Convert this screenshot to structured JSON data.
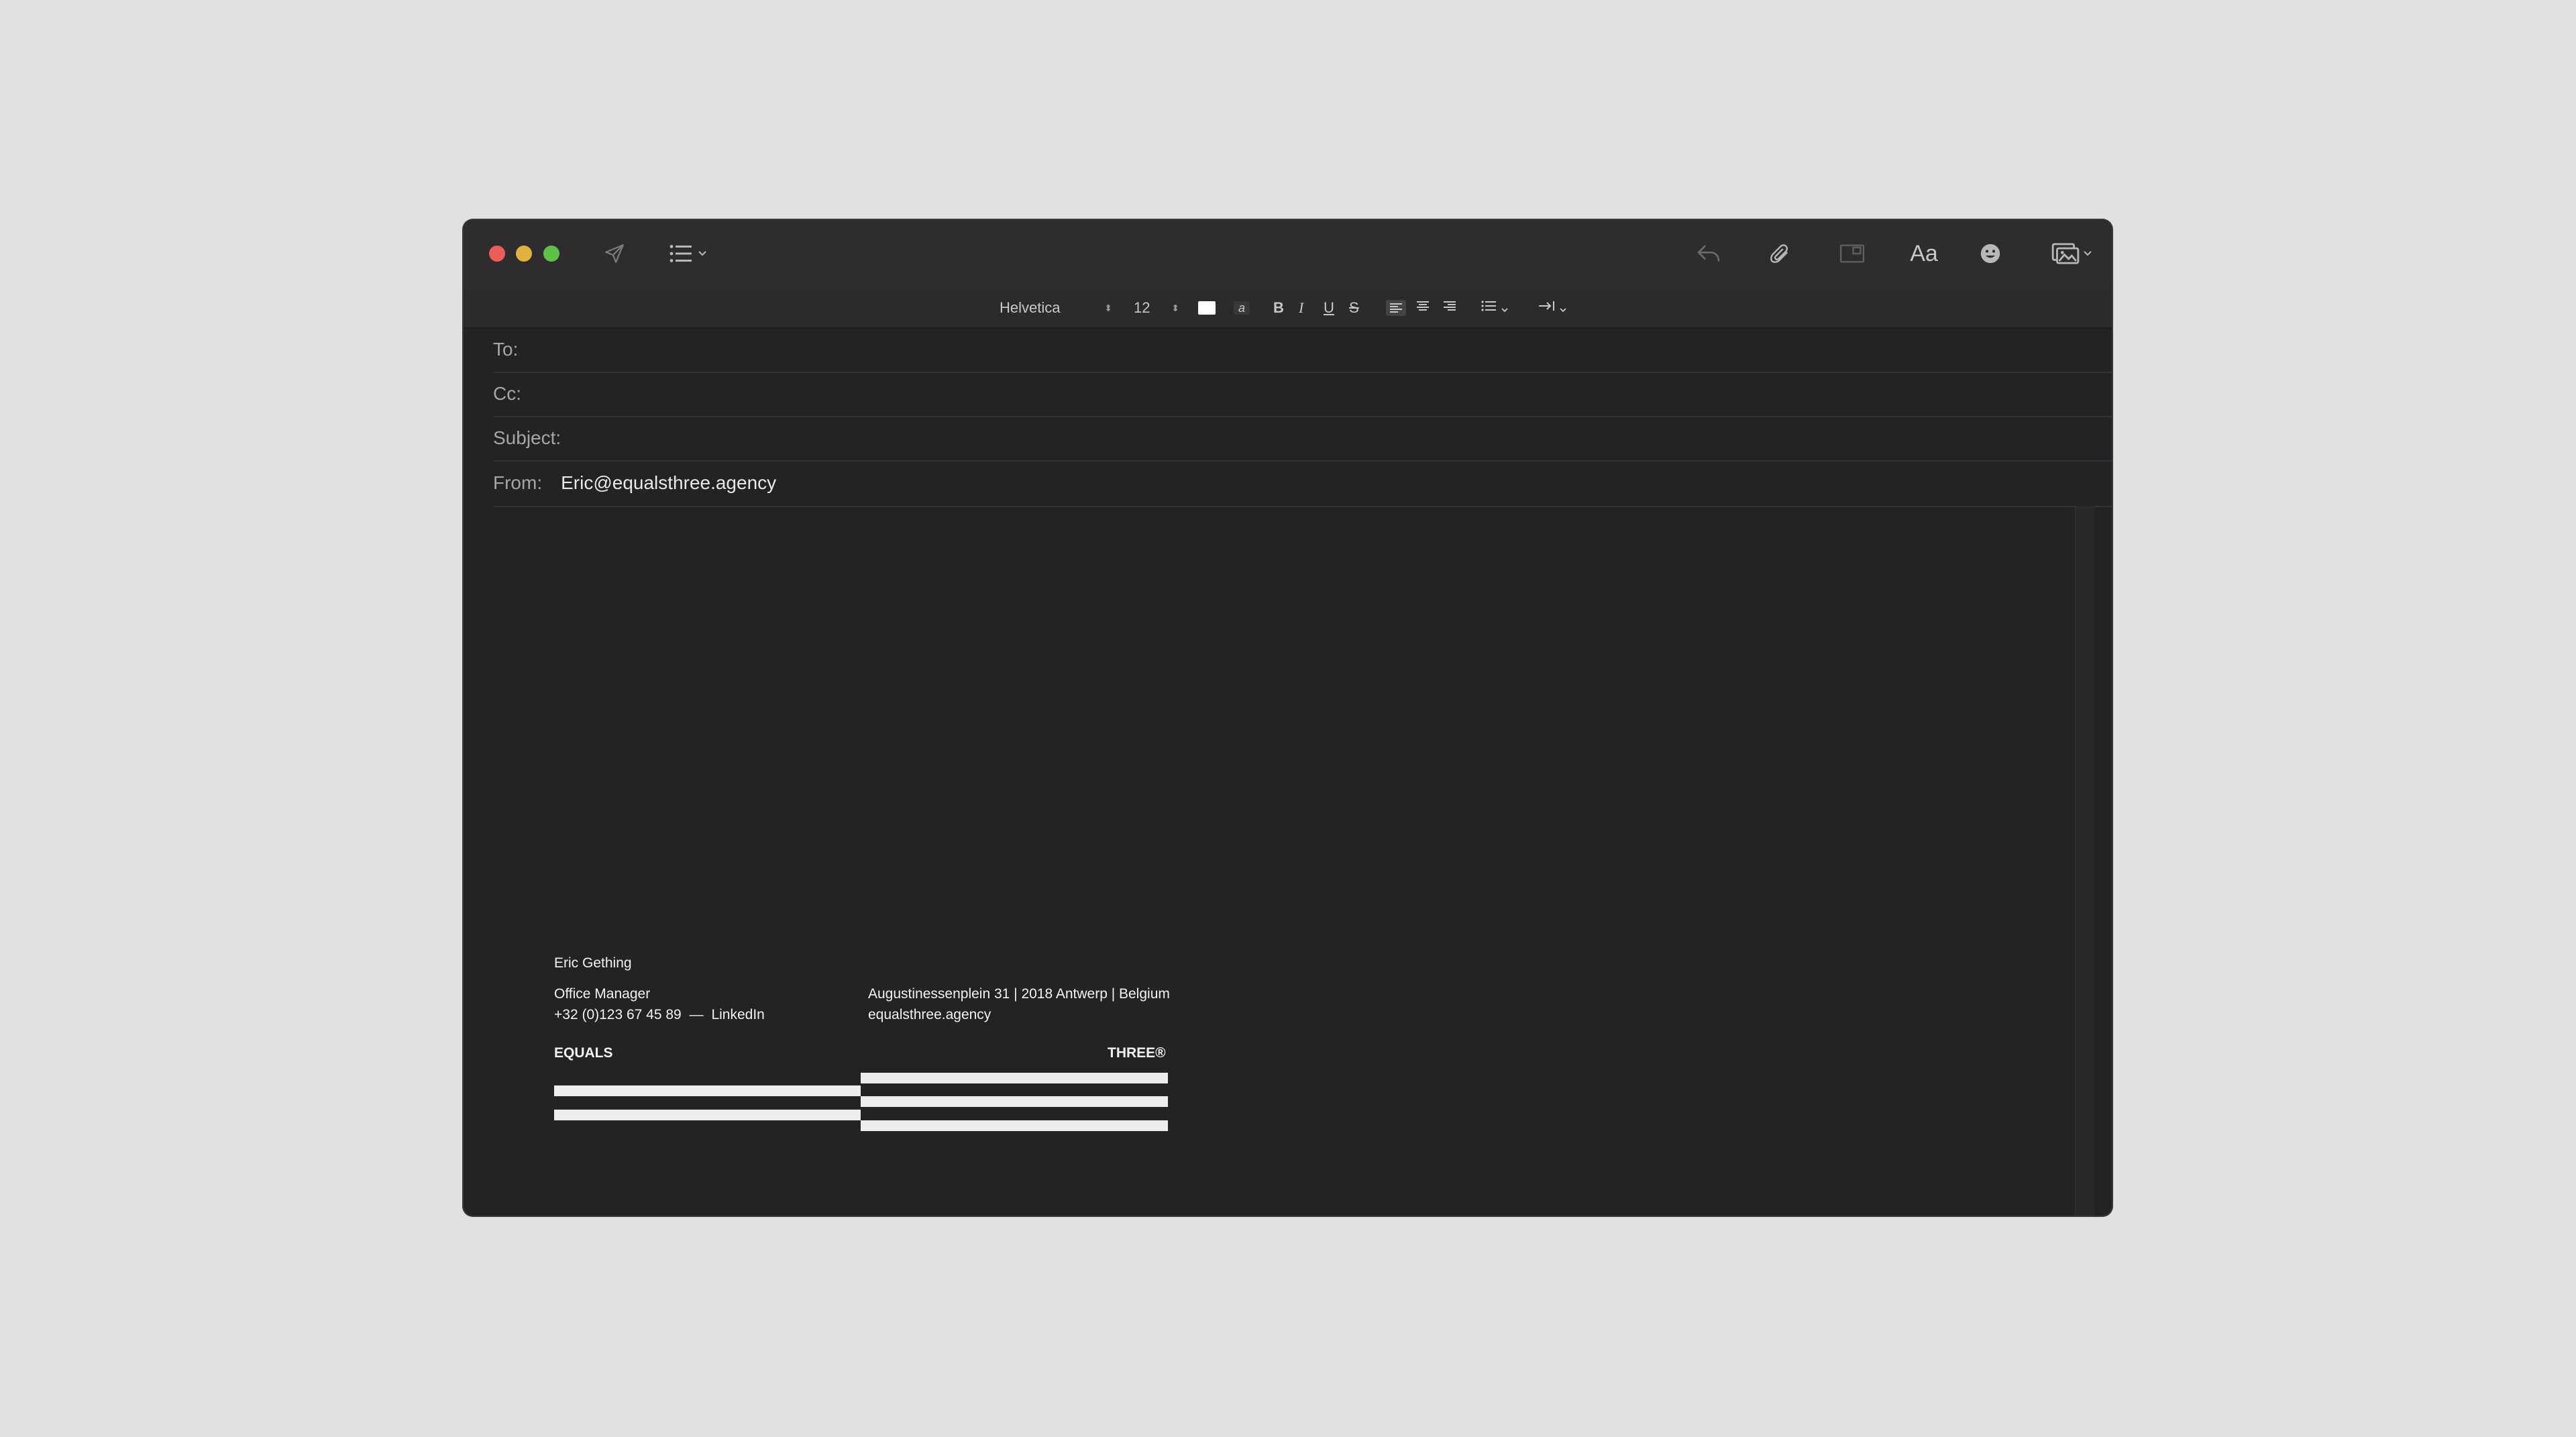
{
  "toolbar": {
    "icons": [
      "send-icon",
      "list-icon",
      "reply-icon",
      "paperclip-icon",
      "markup-icon",
      "font-icon",
      "emoji-icon",
      "photo-icon"
    ],
    "font_button_label": "Aa"
  },
  "format_bar": {
    "font_family": "Helvetica",
    "font_size": "12",
    "bold": "B",
    "italic": "I",
    "underline": "U",
    "strikethrough": "S",
    "text_color": "#ffffff",
    "highlight_glyph": "a"
  },
  "fields": {
    "to_label": "To:",
    "cc_label": "Cc:",
    "subject_label": "Subject:",
    "from_label": "From:",
    "from_value": "Eric@equalsthree.agency"
  },
  "signature": {
    "name": "Eric Gething",
    "title": "Office Manager",
    "phone": "+32 (0)123 67 45 89",
    "separator": "—",
    "linkedin": "LinkedIn",
    "address": "Augustinessenplein 31 | 2018 Antwerp | Belgium",
    "website": "equalsthree.agency",
    "logo_left": "EQUALS",
    "logo_right": "THREE®"
  },
  "colors": {
    "window_bg": "#252225",
    "desktop_bg": "#e1e1e1",
    "close": "#ec5f58",
    "minimize": "#e0b13c",
    "zoom": "#5fc148"
  }
}
